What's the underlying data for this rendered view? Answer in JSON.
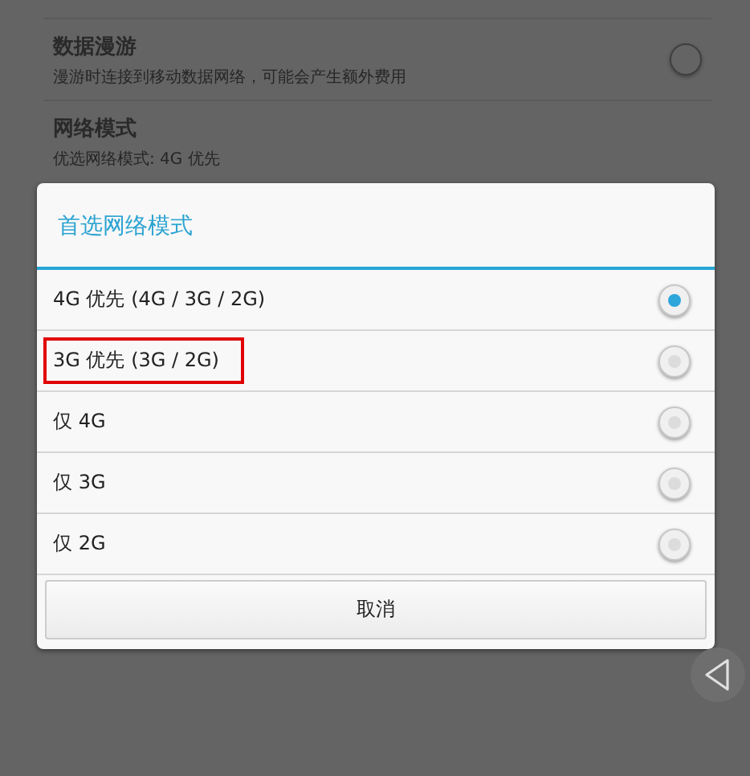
{
  "settings": [
    {
      "title": "数据漫游",
      "subtitle": "漫游时连接到移动数据网络，可能会产生额外费用",
      "kind": "toggle",
      "on": false
    },
    {
      "title": "网络模式",
      "subtitle": "优选网络模式: 4G 优先",
      "kind": "text"
    }
  ],
  "dialog": {
    "title": "首选网络模式",
    "options": [
      {
        "label": "4G 优先 (4G / 3G / 2G)",
        "selected": true,
        "highlighted": false
      },
      {
        "label": "3G 优先 (3G / 2G)",
        "selected": false,
        "highlighted": true
      },
      {
        "label": "仅 4G",
        "selected": false,
        "highlighted": false
      },
      {
        "label": "仅 3G",
        "selected": false,
        "highlighted": false
      },
      {
        "label": "仅 2G",
        "selected": false,
        "highlighted": false
      }
    ],
    "cancel": "取消"
  }
}
